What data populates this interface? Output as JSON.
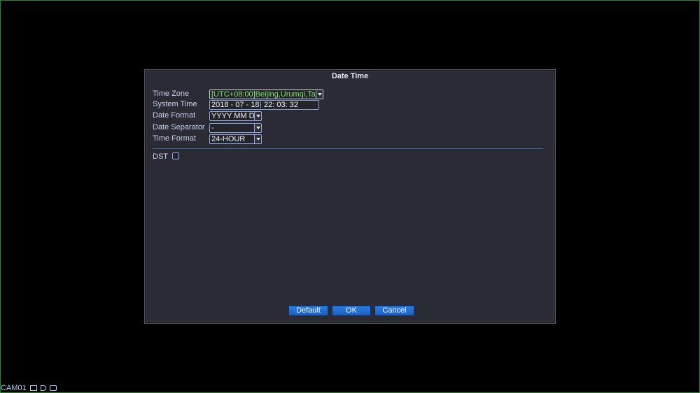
{
  "dialog": {
    "title": "Date Time",
    "time_zone": {
      "label": "Time Zone",
      "value": "[UTC+08:00]Beijing,Urumqi,Ta"
    },
    "system_time": {
      "label": "System Time",
      "date": "2018 - 07 - 18",
      "time": "22: 03: 32"
    },
    "date_format": {
      "label": "Date Format",
      "value": "YYYY MM D"
    },
    "date_separator": {
      "label": "Date Separator",
      "value": "-"
    },
    "time_format": {
      "label": "Time Format",
      "value": "24-HOUR"
    },
    "dst": {
      "label": "DST",
      "checked": false
    },
    "buttons": {
      "default": "Default",
      "ok": "OK",
      "cancel": "Cancel"
    }
  },
  "status_bar": {
    "channel": "CAM01",
    "icons": [
      "record-icon",
      "audio-muted-icon",
      "motion-icon"
    ]
  },
  "colors": {
    "dialog_bg": "#2b2b35",
    "field_border": "#8ea6e0",
    "selected_text": "#7ae06a",
    "button_blue": "#1f6bd0"
  }
}
